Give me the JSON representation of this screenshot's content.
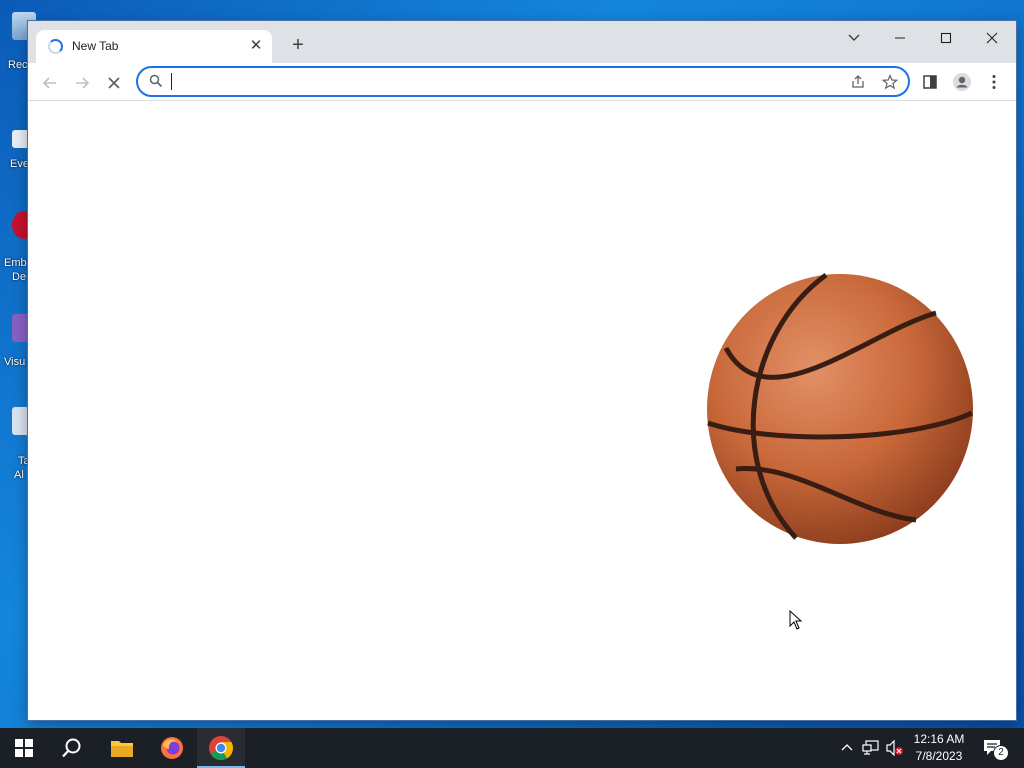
{
  "desktop": {
    "icons": [
      {
        "label": "Rec"
      },
      {
        "label": "Eve"
      },
      {
        "label": "Emb",
        "label2": "De"
      },
      {
        "label": "Visu"
      },
      {
        "label": "Ta",
        "label2": "Al"
      }
    ]
  },
  "browser": {
    "tab": {
      "title": "New Tab",
      "close_glyph": "✕",
      "icon": "loading-spinner-icon"
    },
    "new_tab_glyph": "+",
    "window_controls": {
      "tab_search": "⌄",
      "minimize": "—",
      "maximize": "☐",
      "close": "✕"
    },
    "omnibox": {
      "value": "",
      "placeholder": ""
    },
    "icons": {
      "back": "←",
      "forward": "→",
      "stop": "✕",
      "share": "share-icon",
      "bookmark": "☆",
      "side_panel": "side-panel-icon",
      "profile": "profile-icon",
      "menu": "⋮"
    },
    "page_image": "basketball"
  },
  "taskbar": {
    "apps": [
      "start-icon",
      "search-icon",
      "file-explorer-icon",
      "firefox-icon",
      "chrome-icon"
    ],
    "clock": {
      "time": "12:16 AM",
      "date": "7/8/2023"
    },
    "notification_count": "2"
  },
  "colors": {
    "accent": "#1a73e8",
    "tabstrip": "#dee1e6",
    "taskbar": "#1b1f26"
  }
}
